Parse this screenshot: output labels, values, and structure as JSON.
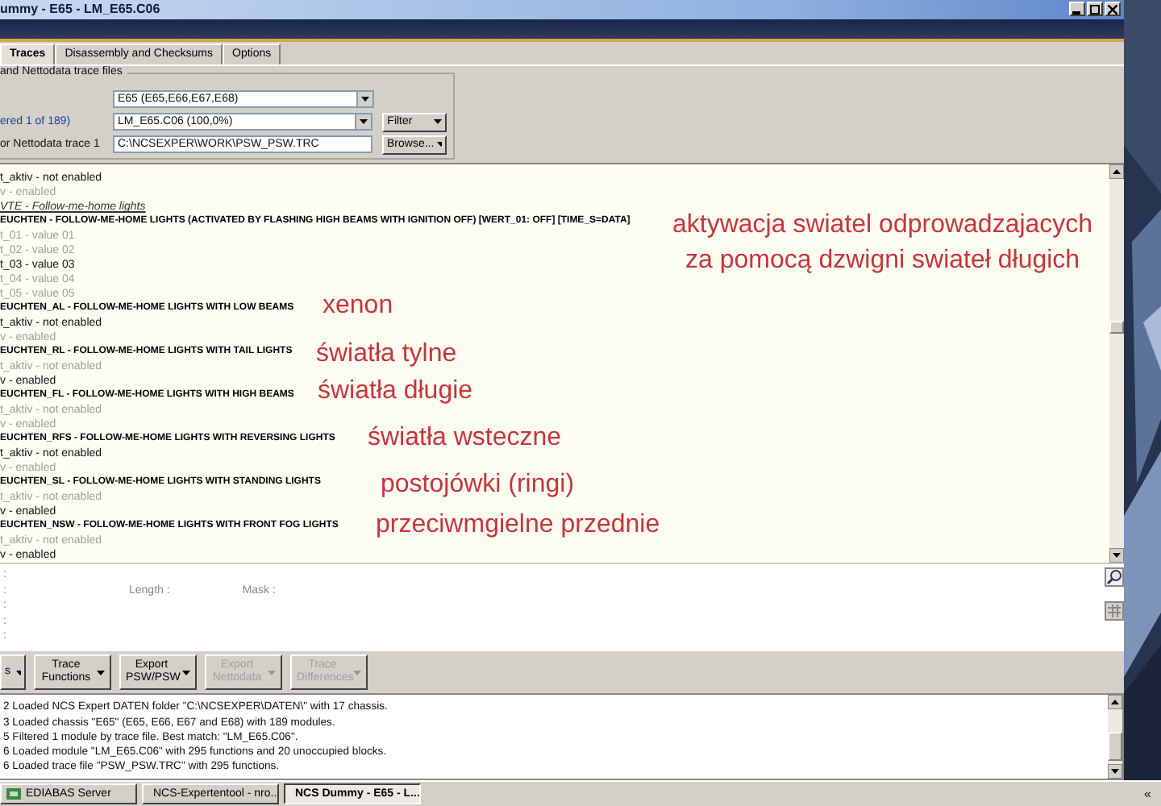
{
  "window": {
    "title": "ummy - E65 - LM_E65.C06"
  },
  "tabs": [
    {
      "label": "Traces",
      "selected": true
    },
    {
      "label": "Disassembly and Checksums",
      "selected": false
    },
    {
      "label": "Options",
      "selected": false
    }
  ],
  "trace_files": {
    "title": "and Nettodata trace files",
    "chassis": {
      "value": "E65  (E65,E66,E67,E68)"
    },
    "module_label": "ered 1 of 189)",
    "module": {
      "value": "LM_E65.C06  (100,0%)"
    },
    "filter_button": "Filter",
    "trace_label": "or Nettodata trace 1",
    "trace_file": {
      "value": "C:\\NCSEXPER\\WORK\\PSW_PSW.TRC"
    },
    "browse_button": "Browse..."
  },
  "functions": {
    "rows": [
      {
        "kind": "value",
        "text": "t_aktiv  -  not enabled",
        "selected": true
      },
      {
        "kind": "value",
        "text": "v  -  enabled",
        "selected": false
      },
      {
        "kind": "header",
        "text": "VTE  -  Follow-me-home lights"
      },
      {
        "kind": "function",
        "text": "EUCHTEN  -  FOLLOW-ME-HOME LIGHTS (ACTIVATED BY FLASHING HIGH BEAMS WITH IGNITION OFF) [WERT_01: OFF] [TIME_S=DATA]"
      },
      {
        "kind": "value",
        "text": "t_01  -  value 01",
        "selected": false
      },
      {
        "kind": "value",
        "text": "t_02  -  value 02",
        "selected": false
      },
      {
        "kind": "value",
        "text": "t_03  -  value 03",
        "selected": true
      },
      {
        "kind": "value",
        "text": "t_04  -  value 04",
        "selected": false
      },
      {
        "kind": "value",
        "text": "t_05  -  value 05",
        "selected": false
      },
      {
        "kind": "function",
        "text": "EUCHTEN_AL  -  FOLLOW-ME-HOME LIGHTS WITH LOW BEAMS"
      },
      {
        "kind": "value",
        "text": "t_aktiv  -  not enabled",
        "selected": true
      },
      {
        "kind": "value",
        "text": "v  -  enabled",
        "selected": false
      },
      {
        "kind": "function",
        "text": "EUCHTEN_RL  -  FOLLOW-ME-HOME LIGHTS WITH TAIL LIGHTS"
      },
      {
        "kind": "value",
        "text": "t_aktiv  -  not enabled",
        "selected": false
      },
      {
        "kind": "value",
        "text": "v  -  enabled",
        "selected": true
      },
      {
        "kind": "function",
        "text": "EUCHTEN_FL  -  FOLLOW-ME-HOME LIGHTS WITH HIGH BEAMS"
      },
      {
        "kind": "value",
        "text": "t_aktiv  -  not enabled",
        "selected": false
      },
      {
        "kind": "value",
        "text": "v  -  enabled",
        "selected": false
      },
      {
        "kind": "function",
        "text": "EUCHTEN_RFS  -  FOLLOW-ME-HOME LIGHTS WITH REVERSING LIGHTS"
      },
      {
        "kind": "value",
        "text": "t_aktiv  -  not enabled",
        "selected": true
      },
      {
        "kind": "value",
        "text": "v  -  enabled",
        "selected": false
      },
      {
        "kind": "function",
        "text": "EUCHTEN_SL  -  FOLLOW-ME-HOME LIGHTS WITH STANDING LIGHTS"
      },
      {
        "kind": "value",
        "text": "t_aktiv  -  not enabled",
        "selected": false
      },
      {
        "kind": "value",
        "text": "v  -  enabled",
        "selected": true
      },
      {
        "kind": "function",
        "text": "EUCHTEN_NSW  -  FOLLOW-ME-HOME LIGHTS WITH FRONT FOG LIGHTS"
      },
      {
        "kind": "value",
        "text": "t_aktiv  -  not enabled",
        "selected": false
      },
      {
        "kind": "value",
        "text": "v  -  enabled",
        "selected": true
      }
    ]
  },
  "annotations": [
    "aktywacja swiatel odprowadzajacych",
    "za pomocą dzwigni swiateł długich",
    "xenon",
    "światła tylne",
    "światła długie",
    "światła wsteczne",
    "postojówki (ringi)",
    "przeciwmgielne przednie"
  ],
  "details": {
    "markers": [
      ":",
      ":",
      ":",
      ":",
      ":"
    ],
    "length_label": "Length :",
    "mask_label": "Mask :"
  },
  "toolbar": [
    {
      "label": "s",
      "disabled": false
    },
    {
      "label": "Trace Functions",
      "disabled": false
    },
    {
      "label": "Export PSW/PSW",
      "disabled": false
    },
    {
      "label": "Export Nettodata",
      "disabled": true
    },
    {
      "label": "Trace Differences",
      "disabled": true
    }
  ],
  "log": [
    "2  Loaded NCS Expert DATEN folder \"C:\\NCSEXPER\\DATEN\\\" with 17 chassis.",
    "3  Loaded chassis \"E65\" (E65, E66, E67 and E68) with 189 modules.",
    "5  Filtered 1 module by trace file. Best match: \"LM_E65.C06\".",
    "6  Loaded module \"LM_E65.C06\" with 295 functions and 20 unoccupied blocks.",
    "6  Loaded trace file \"PSW_PSW.TRC\" with 295 functions."
  ],
  "taskbar": [
    {
      "label": "EDIABAS Server",
      "selected": false
    },
    {
      "label": "NCS-Expertentool - nro...",
      "selected": false
    },
    {
      "label": "NCS Dummy - E65 - L...",
      "selected": true
    }
  ],
  "tray": "«"
}
